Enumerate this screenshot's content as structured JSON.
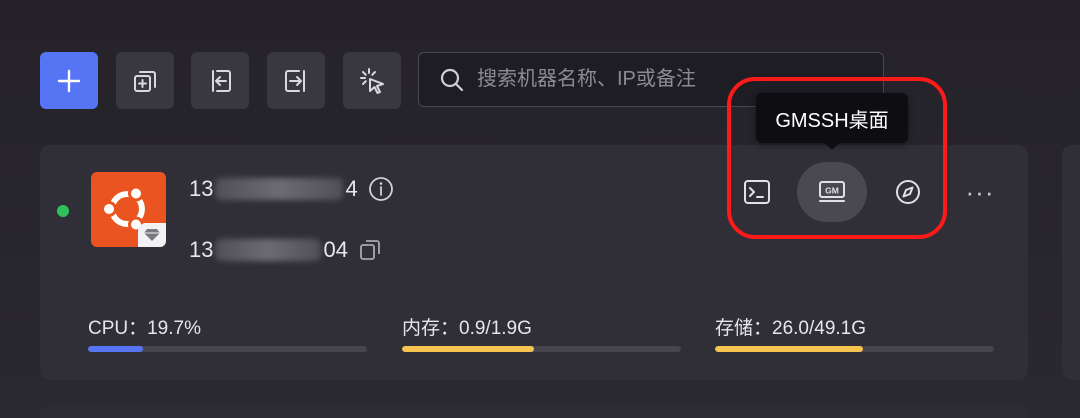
{
  "toolbar": {
    "add_icon": "plus-icon",
    "copy_icon": "copy-add-icon",
    "import_icon": "import-icon",
    "export_icon": "export-icon",
    "select_icon": "click-select-icon",
    "primary_color": "#5575f5"
  },
  "search": {
    "placeholder": "搜索机器名称、IP或备注",
    "value": ""
  },
  "server": {
    "status_color": "#2fc25b",
    "os_logo": "ubuntu-logo",
    "ip_public_prefix": "13",
    "ip_public_suffix": "4",
    "ip_private_prefix": "13",
    "ip_private_suffix": "04"
  },
  "actions": {
    "terminal_icon": "terminal-icon",
    "gm_desktop_icon": "gm-desktop-icon",
    "gm_desktop_icon_text": "GM",
    "browser_icon": "compass-icon",
    "more_label": "···",
    "tooltip": "GMSSH桌面"
  },
  "metrics": {
    "cpu": {
      "label": "CPU：19.7%",
      "percent": 19.7,
      "color": "#5575f5"
    },
    "memory": {
      "label": "内存：0.9/1.9G",
      "percent": 47.4,
      "color": "#f5c451"
    },
    "storage": {
      "label": "存储：26.0/49.1G",
      "percent": 53.0,
      "color": "#f5c451"
    }
  },
  "highlight_color": "#ff1a1a"
}
